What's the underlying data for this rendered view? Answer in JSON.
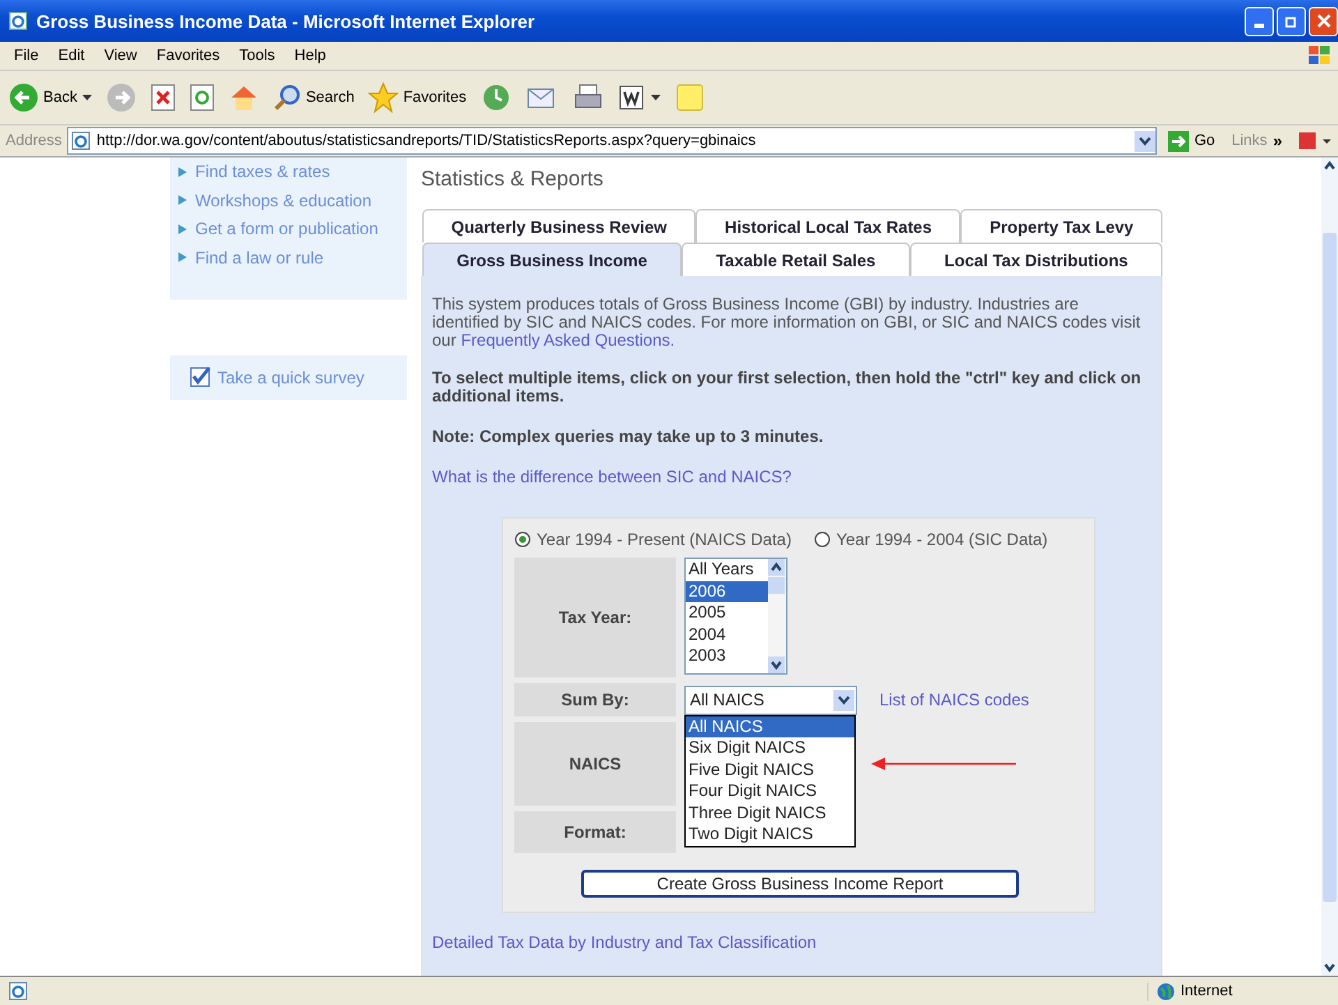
{
  "window": {
    "title": "Gross Business Income Data - Microsoft Internet Explorer"
  },
  "menu": [
    "File",
    "Edit",
    "View",
    "Favorites",
    "Tools",
    "Help"
  ],
  "toolbar": {
    "back": "Back",
    "search": "Search",
    "favorites": "Favorites"
  },
  "address_bar": {
    "label": "Address",
    "url": "http://dor.wa.gov/content/aboutus/statisticsandreports/TID/StatisticsReports.aspx?query=gbinaics",
    "go": "Go",
    "links": "Links",
    "more": "»"
  },
  "sidebar": {
    "items": [
      "Find taxes & rates",
      "Workshops & education",
      "Get a form or publication",
      "Find a law or rule"
    ],
    "survey": {
      "label": "Take a quick survey",
      "checked": true
    }
  },
  "heading": "Statistics & Reports",
  "tab_rows": [
    [
      {
        "label": "Quarterly Business Review",
        "selected": false
      },
      {
        "label": "Historical Local Tax Rates",
        "selected": false
      },
      {
        "label": "Property Tax Levy",
        "selected": false
      }
    ],
    [
      {
        "label": "Gross Business Income",
        "selected": true
      },
      {
        "label": "Taxable Retail Sales",
        "selected": false
      },
      {
        "label": "Local Tax Distributions",
        "selected": false
      }
    ]
  ],
  "intro": {
    "text": "This system produces totals of Gross Business Income (GBI) by industry. Industries are identified by SIC and NAICS codes. For more information on GBI, or SIC and NAICS codes visit our",
    "link": "Frequently Asked Questions."
  },
  "instructions": [
    "To select multiple items, click on your first selection, then hold the \"ctrl\" key and click on additional items.",
    "Note: Complex queries may take up to 3 minutes."
  ],
  "difference_link": "What is the difference between SIC and NAICS?",
  "form": {
    "radios": [
      {
        "label": "Year 1994 - Present (NAICS Data)",
        "selected": true
      },
      {
        "label": "Year 1994 - 2004 (SIC Data)",
        "selected": false
      }
    ],
    "tax_year": {
      "label": "Tax Year:",
      "options": [
        {
          "label": "All Years",
          "selected": false
        },
        {
          "label": "2006",
          "selected": true
        },
        {
          "label": "2005",
          "selected": false
        },
        {
          "label": "2004",
          "selected": false
        },
        {
          "label": "2003",
          "selected": false
        }
      ]
    },
    "sum_by": {
      "label": "Sum By:",
      "value": "All NAICS",
      "expanded": true,
      "options": [
        {
          "label": "All NAICS",
          "selected": true
        },
        {
          "label": "Six Digit NAICS",
          "selected": false
        },
        {
          "label": "Five Digit NAICS",
          "selected": false
        },
        {
          "label": "Four Digit NAICS",
          "selected": false
        },
        {
          "label": "Three Digit NAICS",
          "selected": false
        },
        {
          "label": "Two Digit NAICS",
          "selected": false
        }
      ],
      "link": "List of NAICS codes"
    },
    "naics_label": "NAICS",
    "format_label": "Format:",
    "button": "Create Gross Business Income Report"
  },
  "bottom_link": "Detailed Tax Data by Industry and Tax Classification",
  "status_bar": {
    "zone": "Internet"
  }
}
